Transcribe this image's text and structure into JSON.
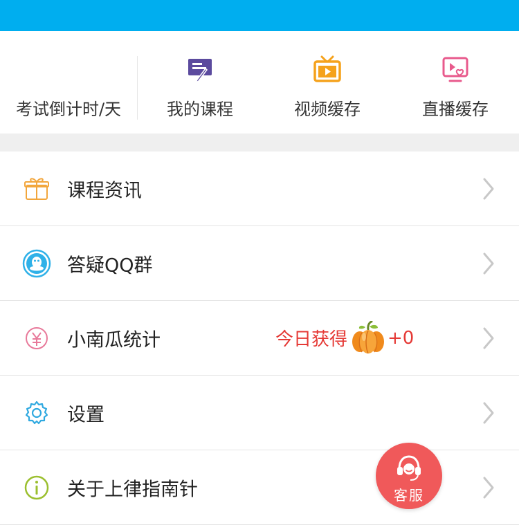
{
  "colors": {
    "status_bar": "#00aeef",
    "accent_red": "#e53935",
    "service_button": "#f0595a"
  },
  "top_nav": {
    "countdown_label": "考试倒计时/天",
    "items": [
      {
        "label": "我的课程",
        "icon": "course-icon"
      },
      {
        "label": "视频缓存",
        "icon": "tv-icon"
      },
      {
        "label": "直播缓存",
        "icon": "live-screen-icon"
      }
    ]
  },
  "menu": {
    "items": [
      {
        "label": "课程资讯",
        "icon": "gift-icon"
      },
      {
        "label": "答疑QQ群",
        "icon": "qq-penguin-icon"
      },
      {
        "label": "小南瓜统计",
        "icon": "yen-coin-icon",
        "extra_text": "今日获得",
        "extra_value": "+0"
      },
      {
        "label": "设置",
        "icon": "gear-icon"
      },
      {
        "label": "关于上律指南针",
        "icon": "info-icon"
      }
    ]
  },
  "service_button": {
    "label": "客服",
    "icon": "headset-icon"
  }
}
